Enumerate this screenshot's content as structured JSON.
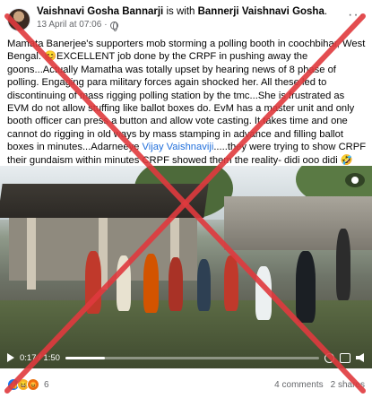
{
  "post": {
    "author": "Vaishnavi Gosha Bannarji",
    "is_with_text": "is with",
    "tagged": "Bannerji Vaishnavi Gosha",
    "timestamp": "13 April at 07:06",
    "separator": "·",
    "more_label": "···",
    "body_before_link": "Mamata Banerjee's supporters mob storming a polling booth in coochbihar, West Bengal. 😊EXCELLENT job done by the CRPF in pushing away the goons...Actually Mamatha was totally upset by hearing news of 8 phase of polling. Engaging para military forces again shocked her. All these led to discontinuing of mass rigging polling station by the tmc...She is frustrated as EVM do not allow stuffing like ballot boxes do. EvM has a master unit and only booth officer can press a button and allow vote casting. It takes time and one cannot do rigging in old ways by mass stamping in advance and filling ballot boxes in minutes...Adarneeye ",
    "body_link": "Vijay Vaishnaviji",
    "body_after_link": ".....they were trying to show CRPF their gundaism within minutes CRPF showed them the reality- didi ooo didi 🤣🤣.."
  },
  "video": {
    "time_display": "0:17 / 1:50",
    "progress_fraction": 0.155
  },
  "footer": {
    "reaction_count": "6",
    "comments": "4 comments",
    "shares": "2 shares"
  },
  "colors": {
    "link": "#216fdb",
    "cross": "#e03a3e",
    "like": "#1877f2"
  },
  "icons": [
    "avatar",
    "globe-icon",
    "more-icon",
    "camera-icon",
    "play-icon",
    "volume-icon",
    "settings-icon",
    "fullscreen-icon",
    "like-reaction-icon",
    "haha-reaction-icon",
    "angry-reaction-icon"
  ]
}
